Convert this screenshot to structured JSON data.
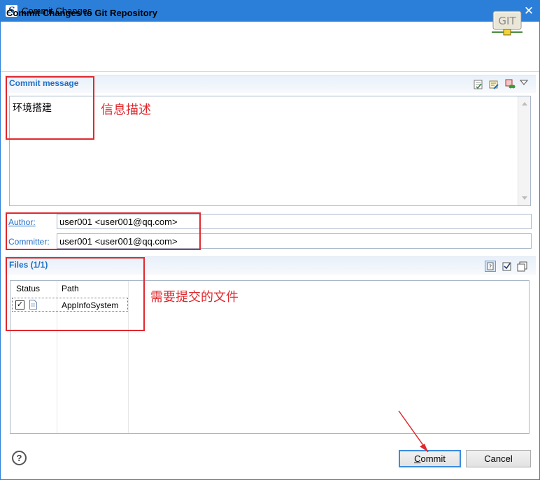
{
  "window": {
    "title": "Commit Changes",
    "close_glyph": "✕",
    "app_icon": "eclipse-sts-icon"
  },
  "header": {
    "title": "Commit Changes to Git Repository",
    "logo_text": "GIT"
  },
  "commit_message": {
    "section_title": "Commit message",
    "text": "环境搭建",
    "toolbar_icons": [
      "spell-check-icon",
      "add-signed-off-icon",
      "amend-icon",
      "menu-dropdown-icon"
    ]
  },
  "identity": {
    "author_label": "Author:",
    "author_value": "user001 <user001@qq.com>",
    "committer_label": "Committer:",
    "committer_value": "user001 <user001@qq.com>"
  },
  "files": {
    "section_title": "Files (1/1)",
    "columns": [
      "Status",
      "Path"
    ],
    "rows": [
      {
        "checked": true,
        "status_icon": "modified-file-icon",
        "path": "AppInfoSystem"
      }
    ],
    "toolbar_icons": [
      "show-untracked-icon",
      "select-all-icon",
      "deselect-all-icon"
    ]
  },
  "buttons": {
    "help": "?",
    "commit": "Commit",
    "cancel": "Cancel"
  },
  "annotations": {
    "message_note": "信息描述",
    "files_note": "需要提交的文件"
  },
  "colors": {
    "titlebar": "#2b7fd8",
    "section_title": "#1f6fc5",
    "annotation": "#e0282d"
  }
}
